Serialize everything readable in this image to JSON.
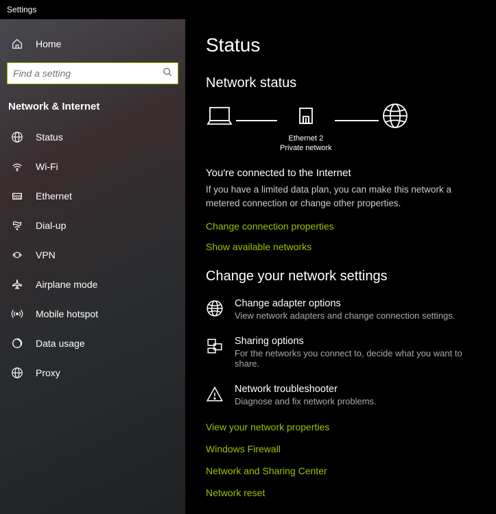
{
  "window": {
    "title": "Settings"
  },
  "sidebar": {
    "home": "Home",
    "search_placeholder": "Find a setting",
    "section": "Network & Internet",
    "items": [
      {
        "icon": "status",
        "label": "Status"
      },
      {
        "icon": "wifi",
        "label": "Wi-Fi"
      },
      {
        "icon": "ethernet",
        "label": "Ethernet"
      },
      {
        "icon": "dialup",
        "label": "Dial-up"
      },
      {
        "icon": "vpn",
        "label": "VPN"
      },
      {
        "icon": "airplane",
        "label": "Airplane mode"
      },
      {
        "icon": "hotspot",
        "label": "Mobile hotspot"
      },
      {
        "icon": "datausage",
        "label": "Data usage"
      },
      {
        "icon": "proxy",
        "label": "Proxy"
      }
    ]
  },
  "main": {
    "title": "Status",
    "network_status_heading": "Network status",
    "diagram": {
      "device": "",
      "router_line1": "Ethernet 2",
      "router_line2": "Private network",
      "globe": ""
    },
    "connected_heading": "You're connected to the Internet",
    "connected_body": "If you have a limited data plan, you can make this network a metered connection or change other properties.",
    "link_change_props": "Change connection properties",
    "link_show_networks": "Show available networks",
    "change_heading": "Change your network settings",
    "rows": [
      {
        "title": "Change adapter options",
        "sub": "View network adapters and change connection settings."
      },
      {
        "title": "Sharing options",
        "sub": "For the networks you connect to, decide what you want to share."
      },
      {
        "title": "Network troubleshooter",
        "sub": "Diagnose and fix network problems."
      }
    ],
    "bottom_links": [
      "View your network properties",
      "Windows Firewall",
      "Network and Sharing Center",
      "Network reset"
    ]
  }
}
